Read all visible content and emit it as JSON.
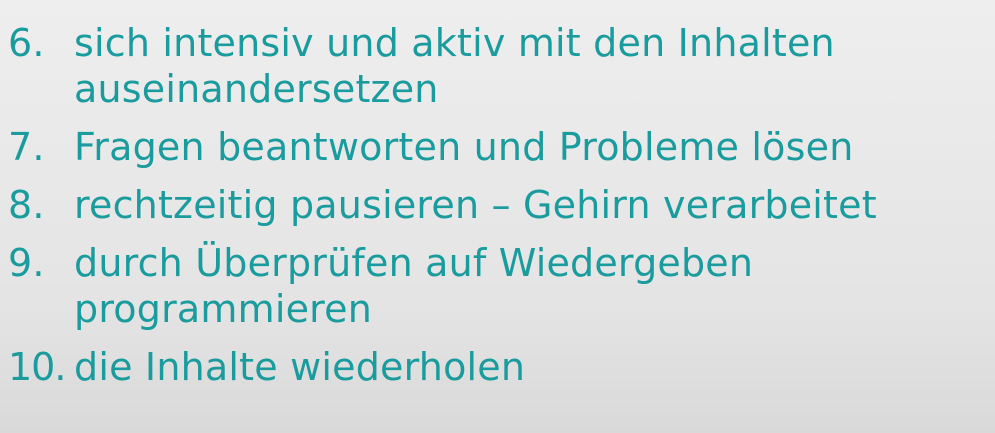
{
  "items": [
    {
      "number": "6.",
      "lines": [
        "sich intensiv und aktiv mit den Inhalten",
        "auseinandersetzen"
      ]
    },
    {
      "number": "7.",
      "lines": [
        "Fragen beantworten und Probleme lösen"
      ]
    },
    {
      "number": "8.",
      "lines": [
        "rechtzeitig pausieren – Gehirn verarbeitet"
      ]
    },
    {
      "number": "9.",
      "lines": [
        "durch Überprüfen auf Wiedergeben",
        "programmieren"
      ]
    },
    {
      "number": "10.",
      "lines": [
        "die Inhalte wiederholen"
      ]
    }
  ],
  "colors": {
    "text": "#1a9c9e",
    "background": "#e8e8e8"
  }
}
